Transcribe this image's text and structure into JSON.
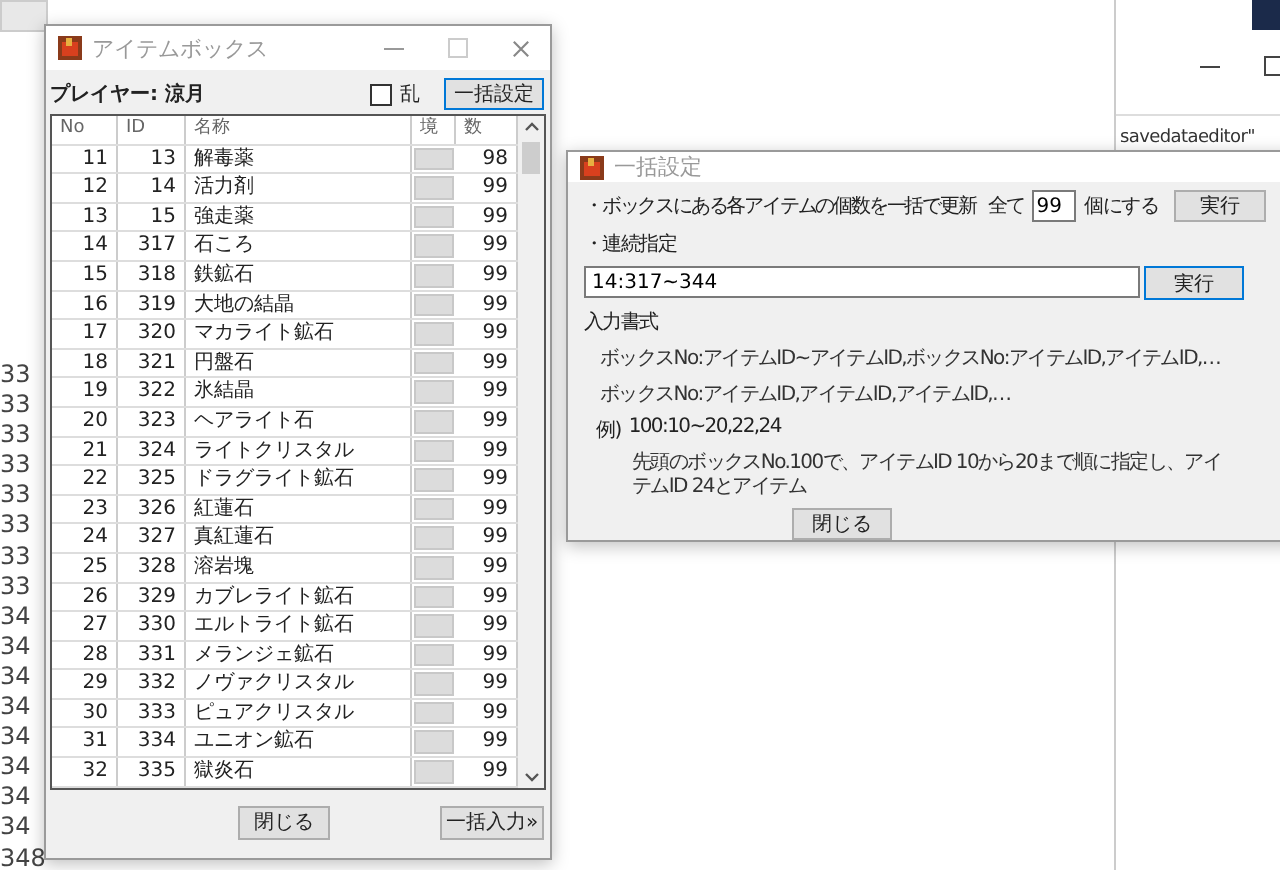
{
  "background_list": {
    "items": [
      "33",
      "33",
      "33",
      "33",
      "33",
      "33",
      "33",
      "33",
      "34",
      "34",
      "34",
      "34",
      "34",
      "34",
      "34",
      "34",
      "348"
    ]
  },
  "background_window": {
    "path_text": "savedataeditor\""
  },
  "item_box": {
    "title": "アイテムボックス",
    "player_label": "プレイヤー: 涼月",
    "random_checkbox": {
      "label": "乱",
      "checked": false
    },
    "bulk_button": "一括設定",
    "columns": [
      "No",
      "ID",
      "名称",
      "境",
      "数"
    ],
    "rows": [
      {
        "no": "11",
        "id": "13",
        "name": "解毒薬",
        "count": "98"
      },
      {
        "no": "12",
        "id": "14",
        "name": "活力剤",
        "count": "99"
      },
      {
        "no": "13",
        "id": "15",
        "name": "強走薬",
        "count": "99"
      },
      {
        "no": "14",
        "id": "317",
        "name": "石ころ",
        "count": "99"
      },
      {
        "no": "15",
        "id": "318",
        "name": "鉄鉱石",
        "count": "99"
      },
      {
        "no": "16",
        "id": "319",
        "name": "大地の結晶",
        "count": "99"
      },
      {
        "no": "17",
        "id": "320",
        "name": "マカライト鉱石",
        "count": "99"
      },
      {
        "no": "18",
        "id": "321",
        "name": "円盤石",
        "count": "99"
      },
      {
        "no": "19",
        "id": "322",
        "name": "氷結晶",
        "count": "99"
      },
      {
        "no": "20",
        "id": "323",
        "name": "ヘアライト石",
        "count": "99"
      },
      {
        "no": "21",
        "id": "324",
        "name": "ライトクリスタル",
        "count": "99"
      },
      {
        "no": "22",
        "id": "325",
        "name": "ドラグライト鉱石",
        "count": "99"
      },
      {
        "no": "23",
        "id": "326",
        "name": "紅蓮石",
        "count": "99"
      },
      {
        "no": "24",
        "id": "327",
        "name": "真紅蓮石",
        "count": "99"
      },
      {
        "no": "25",
        "id": "328",
        "name": "溶岩塊",
        "count": "99"
      },
      {
        "no": "26",
        "id": "329",
        "name": "カブレライト鉱石",
        "count": "99"
      },
      {
        "no": "27",
        "id": "330",
        "name": "エルトライト鉱石",
        "count": "99"
      },
      {
        "no": "28",
        "id": "331",
        "name": "メランジェ鉱石",
        "count": "99"
      },
      {
        "no": "29",
        "id": "332",
        "name": "ノヴァクリスタル",
        "count": "99"
      },
      {
        "no": "30",
        "id": "333",
        "name": "ピュアクリスタル",
        "count": "99"
      },
      {
        "no": "31",
        "id": "334",
        "name": "ユニオン鉱石",
        "count": "99"
      },
      {
        "no": "32",
        "id": "335",
        "name": "獄炎石",
        "count": "99"
      }
    ],
    "close_button": "閉じる",
    "bulk_input_button": "一括入力»"
  },
  "bulk_dialog": {
    "title": "一括設定",
    "update_label": "・ボックスにある各アイテムの個数を一括で更新",
    "all_label": "全て",
    "count_value": "99",
    "count_suffix": "個にする",
    "run_button_1": "実行",
    "range_label": "・連続指定",
    "range_value": "14:317~344",
    "run_button_2": "実行",
    "format_heading": "入力書式",
    "format_lines": [
      "ボックスNo:アイテムID~アイテムID,ボックスNo:アイテムID,アイテムID,…",
      "ボックスNo:アイテムID,アイテムID,アイテムID,…"
    ],
    "example_label": "例)",
    "example_value": "100:10~20,22,24",
    "example_description": "先頭のボックスNo.100で、アイテムID 10から20まで順に指定し、アイテムID 24とアイテム",
    "close_button": "閉じる"
  }
}
